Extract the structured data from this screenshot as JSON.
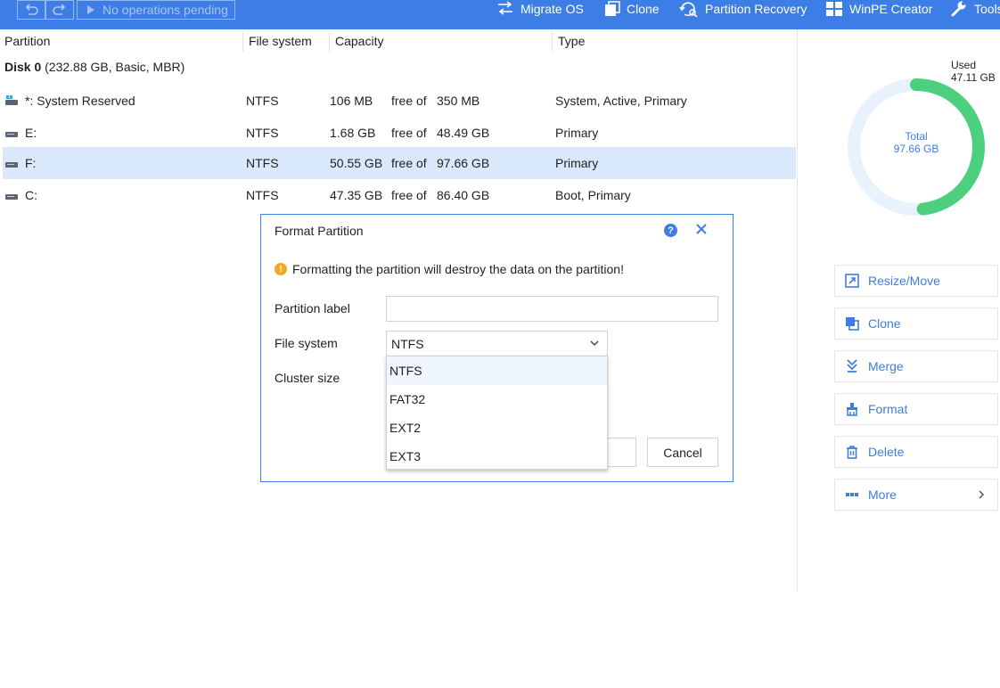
{
  "toolbar": {
    "undo_icon": "undo-icon",
    "redo_icon": "redo-icon",
    "pending_label": "No operations pending",
    "migrate_os": "Migrate OS",
    "clone": "Clone",
    "partition_recovery": "Partition Recovery",
    "winpe_creator": "WinPE Creator",
    "tools": "Tools",
    "color": "#3d7de6"
  },
  "table": {
    "headers": {
      "partition": "Partition",
      "file_system": "File system",
      "capacity": "Capacity",
      "type": "Type"
    },
    "disk": {
      "name": "Disk 0",
      "info": "(232.88 GB, Basic, MBR)"
    },
    "rows": [
      {
        "name": "*: System Reserved",
        "fs": "NTFS",
        "free": "106 MB",
        "free_of": "free of",
        "total": "350 MB",
        "type": "System, Active, Primary",
        "selected": false
      },
      {
        "name": "E:",
        "fs": "NTFS",
        "free": "1.68 GB",
        "free_of": "free of",
        "total": "48.49 GB",
        "type": "Primary",
        "selected": false
      },
      {
        "name": "F:",
        "fs": "NTFS",
        "free": "50.55 GB",
        "free_of": "free of",
        "total": "97.66 GB",
        "type": "Primary",
        "selected": true
      },
      {
        "name": "C:",
        "fs": "NTFS",
        "free": "47.35 GB",
        "free_of": "free of",
        "total": "86.40 GB",
        "type": "Boot, Primary",
        "selected": false
      }
    ]
  },
  "usage": {
    "used_label": "Used",
    "used_value": "47.11 GB",
    "total_label": "Total",
    "total_value": "97.66 GB",
    "used_fraction": 0.4824,
    "used_color": "#4cd07d",
    "track_color": "#e8f1fc"
  },
  "actions": [
    {
      "label": "Resize/Move",
      "icon": "resize-icon"
    },
    {
      "label": "Clone",
      "icon": "clone-icon"
    },
    {
      "label": "Merge",
      "icon": "merge-icon"
    },
    {
      "label": "Format",
      "icon": "format-icon"
    },
    {
      "label": "Delete",
      "icon": "trash-icon"
    },
    {
      "label": "More",
      "icon": "more-icon"
    }
  ],
  "dialog": {
    "title": "Format Partition",
    "warning": "Formatting the partition will destroy the data on the partition!",
    "partition_label_label": "Partition label",
    "partition_label_value": "",
    "file_system_label": "File system",
    "file_system_value": "NTFS",
    "cluster_size_label": "Cluster size",
    "cancel": "Cancel",
    "file_system_options": [
      "NTFS",
      "FAT32",
      "EXT2",
      "EXT3"
    ],
    "highlighted_option": "NTFS"
  }
}
